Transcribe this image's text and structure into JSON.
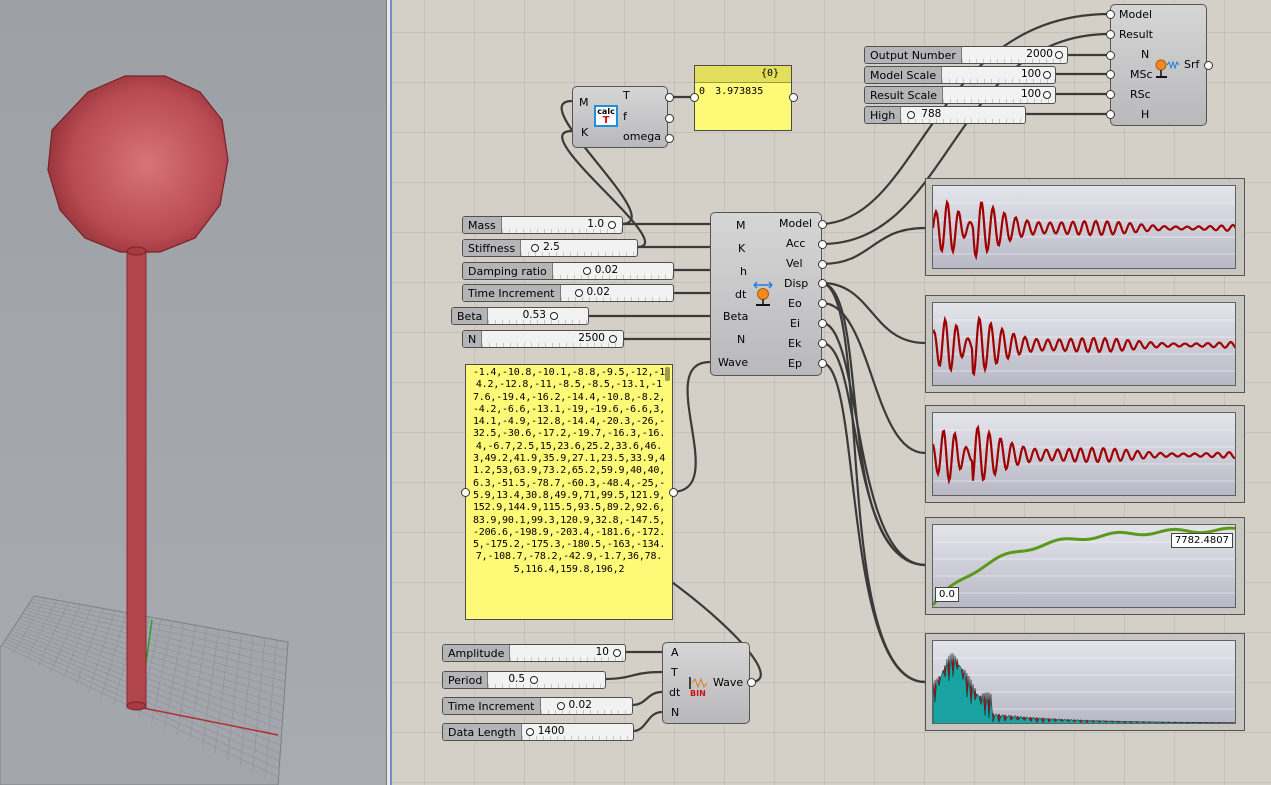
{
  "viewport": {
    "sphere_color": "#b84a52",
    "stem_color": "#b0454c",
    "grid_color": "#8e9298"
  },
  "sliders": {
    "output_number": {
      "label": "Output Number",
      "value": "2000"
    },
    "model_scale": {
      "label": "Model Scale",
      "value": "100"
    },
    "result_scale": {
      "label": "Result Scale",
      "value": "100"
    },
    "high": {
      "label": "High",
      "value": "788"
    },
    "mass": {
      "label": "Mass",
      "value": "1.0"
    },
    "stiffness": {
      "label": "Stiffness",
      "value": "2.5"
    },
    "damping_ratio": {
      "label": "Damping ratio",
      "value": "0.02"
    },
    "time_increment": {
      "label": "Time Increment",
      "value": "0.02"
    },
    "beta": {
      "label": "Beta",
      "value": "0.53"
    },
    "n": {
      "label": "N",
      "value": "2500"
    },
    "amplitude": {
      "label": "Amplitude",
      "value": "10"
    },
    "period": {
      "label": "Period",
      "value": "0.5"
    },
    "wave_time_increment": {
      "label": "Time Increment",
      "value": "0.02"
    },
    "data_length": {
      "label": "Data Length",
      "value": "1400"
    }
  },
  "calc_component": {
    "inputs": [
      "M",
      "K"
    ],
    "outputs": [
      "T",
      "f",
      "omega"
    ],
    "icon_label": "calc"
  },
  "result_panel": {
    "header": "{0}",
    "index": "0",
    "value": "3.973835"
  },
  "solver_component": {
    "inputs": [
      "M",
      "K",
      "h",
      "dt",
      "Beta",
      "N",
      "Wave"
    ],
    "outputs": [
      "Model",
      "Acc",
      "Vel",
      "Disp",
      "Eo",
      "Ei",
      "Ek",
      "Ep"
    ]
  },
  "display_component": {
    "inputs": [
      "Model",
      "Result",
      "N",
      "MSc",
      "RSc",
      "H"
    ],
    "output": "Srf"
  },
  "wave_component": {
    "inputs": [
      "A",
      "T",
      "dt",
      "N"
    ],
    "output": "Wave",
    "icon_label": "BIN"
  },
  "wave_panel": {
    "text": "-1.4,-10.8,-10.1,-8.8,-9.5,-12,-14.2,-12.8,-11,-8.5,-8.5,-13.1,-17.6,-19.4,-16.2,-14.4,-10.8,-8.2,-4.2,-6.6,-13.1,-19,-19.6,-6.6,3,14.1,-4.9,-12.8,-14.4,-20.3,-26,-32.5,-30.6,-17.2,-19.7,-16.3,-16.4,-6.7,2.5,15,23.6,25.2,33.6,46.3,49.2,41.9,35.9,27.1,23.5,33.9,41.2,53,63.9,73.2,65.2,59.9,40,40,6.3,-51.5,-78.7,-60.3,-48.4,-25,-5.9,13.4,30.8,49.9,71,99.5,121.9,152.9,144.9,115.5,93.5,89.2,92.6,83.9,90.1,99.3,120.9,32.8,-147.5,-206.6,-198.9,-203.4,-181.6,-172.5,-175.2,-175.3,-180.5,-163,-134.7,-108.7,-78.2,-42.9,-1.7,36,78.5,116.4,159.8,196,2"
  },
  "graphs": {
    "energy_max_label": "7782.4807",
    "energy_min_label": "0.0",
    "wave_color": "#a00000",
    "energy_color": "#5a9a18",
    "spectrum_color_a": "#b01818",
    "spectrum_color_b": "#1aa3a3"
  }
}
